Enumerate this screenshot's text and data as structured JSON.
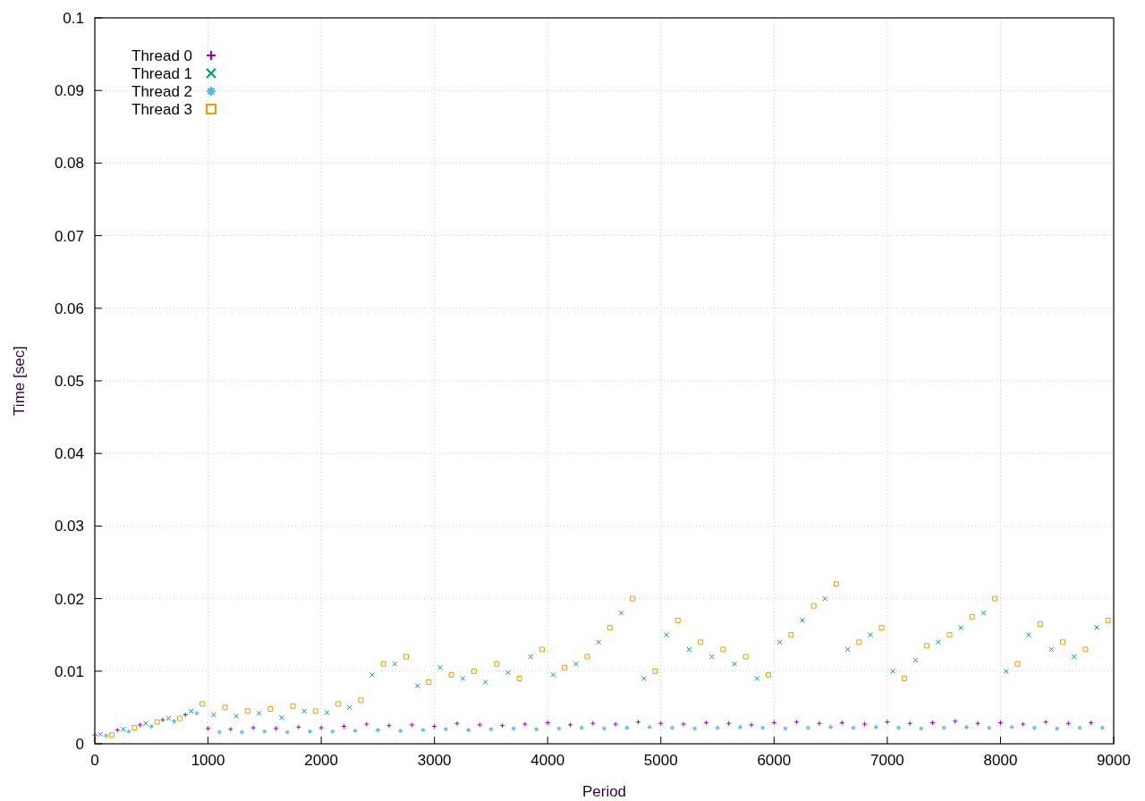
{
  "chart_data": {
    "type": "scatter",
    "xlabel": "Period",
    "ylabel": "Time [sec]",
    "xlim": [
      0,
      9000
    ],
    "ylim": [
      0,
      0.1
    ],
    "grid": true,
    "legend": "top-left",
    "xticks": [
      0,
      1000,
      2000,
      3000,
      4000,
      5000,
      6000,
      7000,
      8000,
      9000
    ],
    "yticks": [
      0,
      0.01,
      0.02,
      0.03,
      0.04,
      0.05,
      0.06,
      0.07,
      0.08,
      0.09,
      0.1
    ],
    "series": [
      {
        "name": "Thread 0",
        "color": "#9400d3",
        "x": [
          0,
          200,
          400,
          600,
          800,
          1000,
          1200,
          1400,
          1600,
          1800,
          2000,
          2200,
          2400,
          2600,
          2800,
          3000,
          3200,
          3400,
          3600,
          3800,
          4000,
          4200,
          4400,
          4600,
          4800,
          5000,
          5200,
          5400,
          5600,
          5800,
          6000,
          6200,
          6400,
          6600,
          6800,
          7000,
          7200,
          7400,
          7600,
          7800,
          8000,
          8200,
          8400,
          8600,
          8800
        ],
        "values": [
          0.0012,
          0.0019,
          0.0026,
          0.0033,
          0.004,
          0.0021,
          0.002,
          0.0022,
          0.0021,
          0.0023,
          0.0022,
          0.0024,
          0.0027,
          0.0025,
          0.0026,
          0.0024,
          0.0028,
          0.0026,
          0.0025,
          0.0027,
          0.0029,
          0.0026,
          0.0028,
          0.0027,
          0.003,
          0.0028,
          0.0027,
          0.0029,
          0.0028,
          0.0026,
          0.0029,
          0.003,
          0.0028,
          0.0029,
          0.0027,
          0.003,
          0.0028,
          0.0029,
          0.0031,
          0.0028,
          0.0029,
          0.0027,
          0.003,
          0.0028,
          0.0029
        ]
      },
      {
        "name": "Thread 1",
        "color": "#009e73",
        "x": [
          50,
          250,
          450,
          650,
          850,
          1050,
          1250,
          1450,
          1650,
          1850,
          2050,
          2250,
          2450,
          2650,
          2850,
          3050,
          3250,
          3450,
          3650,
          3850,
          4050,
          4250,
          4450,
          4650,
          4850,
          5050,
          5250,
          5450,
          5650,
          5850,
          6050,
          6250,
          6450,
          6650,
          6850,
          7050,
          7250,
          7450,
          7650,
          7850,
          8050,
          8250,
          8450,
          8650,
          8850
        ],
        "values": [
          0.0013,
          0.002,
          0.0028,
          0.0035,
          0.0045,
          0.004,
          0.0038,
          0.0042,
          0.0036,
          0.0045,
          0.0043,
          0.005,
          0.0095,
          0.011,
          0.008,
          0.0105,
          0.009,
          0.0085,
          0.0098,
          0.012,
          0.0095,
          0.011,
          0.014,
          0.018,
          0.009,
          0.015,
          0.013,
          0.012,
          0.011,
          0.009,
          0.014,
          0.017,
          0.02,
          0.013,
          0.015,
          0.01,
          0.0115,
          0.014,
          0.016,
          0.018,
          0.01,
          0.015,
          0.013,
          0.012,
          0.016
        ]
      },
      {
        "name": "Thread 2",
        "color": "#56b4e9",
        "x": [
          100,
          300,
          500,
          700,
          900,
          1100,
          1300,
          1500,
          1700,
          1900,
          2100,
          2300,
          2500,
          2700,
          2900,
          3100,
          3300,
          3500,
          3700,
          3900,
          4100,
          4300,
          4500,
          4700,
          4900,
          5100,
          5300,
          5500,
          5700,
          5900,
          6100,
          6300,
          6500,
          6700,
          6900,
          7100,
          7300,
          7500,
          7700,
          7900,
          8100,
          8300,
          8500,
          8700,
          8900
        ],
        "values": [
          0.0011,
          0.0017,
          0.0024,
          0.0031,
          0.0042,
          0.0016,
          0.0016,
          0.0017,
          0.0016,
          0.0017,
          0.0017,
          0.0018,
          0.0019,
          0.0018,
          0.0019,
          0.002,
          0.0019,
          0.002,
          0.0021,
          0.002,
          0.0021,
          0.0022,
          0.0021,
          0.0022,
          0.0023,
          0.0022,
          0.0021,
          0.0022,
          0.0023,
          0.0022,
          0.0021,
          0.0022,
          0.0023,
          0.0022,
          0.0023,
          0.0022,
          0.0021,
          0.0022,
          0.0023,
          0.0022,
          0.0023,
          0.0022,
          0.0021,
          0.0022,
          0.0022
        ]
      },
      {
        "name": "Thread 3",
        "color": "#e69f00",
        "x": [
          150,
          350,
          550,
          750,
          950,
          1150,
          1350,
          1550,
          1750,
          1950,
          2150,
          2350,
          2550,
          2750,
          2950,
          3150,
          3350,
          3550,
          3750,
          3950,
          4150,
          4350,
          4550,
          4750,
          4950,
          5150,
          5350,
          5550,
          5750,
          5950,
          6150,
          6350,
          6550,
          6750,
          6950,
          7150,
          7350,
          7550,
          7750,
          7950,
          8150,
          8350,
          8550,
          8750,
          8950
        ],
        "values": [
          0.0012,
          0.0022,
          0.003,
          0.0035,
          0.0055,
          0.005,
          0.0045,
          0.0048,
          0.0052,
          0.0045,
          0.0055,
          0.006,
          0.011,
          0.012,
          0.0085,
          0.0095,
          0.01,
          0.011,
          0.009,
          0.013,
          0.0105,
          0.012,
          0.016,
          0.02,
          0.01,
          0.017,
          0.014,
          0.013,
          0.012,
          0.0095,
          0.015,
          0.019,
          0.022,
          0.014,
          0.016,
          0.009,
          0.0135,
          0.015,
          0.0175,
          0.02,
          0.011,
          0.0165,
          0.014,
          0.013,
          0.017
        ]
      }
    ]
  }
}
